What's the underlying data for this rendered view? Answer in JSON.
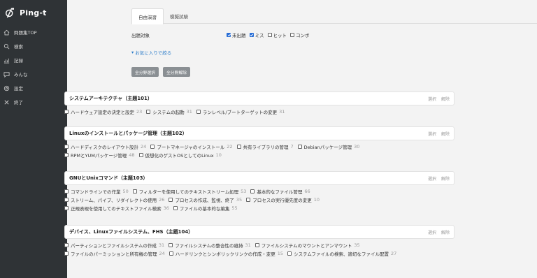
{
  "sidebar": {
    "logo_text": "Ping-t",
    "items": [
      {
        "label": "問題集TOP",
        "icon": "home-icon"
      },
      {
        "label": "検索",
        "icon": "search-icon"
      },
      {
        "label": "記録",
        "icon": "record-icon"
      },
      {
        "label": "みんな",
        "icon": "chat-icon"
      },
      {
        "label": "設定",
        "icon": "gear-icon"
      },
      {
        "label": "終了",
        "icon": "close-icon"
      }
    ]
  },
  "tabs": [
    {
      "label": "自由演習",
      "active": true
    },
    {
      "label": "模擬試験",
      "active": false
    }
  ],
  "filter": {
    "label": "出題対象",
    "options": [
      {
        "label": "未出題",
        "checked": true
      },
      {
        "label": "ミス",
        "checked": true
      },
      {
        "label": "ヒット",
        "checked": false
      },
      {
        "label": "コンボ",
        "checked": false
      }
    ]
  },
  "favorites_link": "お気に入りで絞る",
  "buttons": {
    "select_all": "全分野選択",
    "deselect_all": "全分野解除"
  },
  "card_actions": {
    "select": "選択",
    "release": "解除"
  },
  "sections": [
    {
      "title": "システムアーキテクチャ（主題101）",
      "lines": [
        [
          {
            "label": "ハードウェア設定の決定と設定",
            "count": "23"
          },
          {
            "label": "システムの起動",
            "count": "31"
          },
          {
            "label": "ランレベル/ブートターゲットの変更",
            "count": "31"
          }
        ]
      ]
    },
    {
      "title": "Linuxのインストールとパッケージ管理（主題102）",
      "lines": [
        [
          {
            "label": "ハードディスクのレイアウト設計",
            "count": "24"
          },
          {
            "label": "ブートマネージャのインストール",
            "count": "22"
          },
          {
            "label": "共有ライブラリの管理",
            "count": "7"
          },
          {
            "label": "Debianパッケージ管理",
            "count": "30"
          }
        ],
        [
          {
            "label": "RPMとYUMパッケージ管理",
            "count": "48"
          },
          {
            "label": "仮想化のゲストOSとしてのLinux",
            "count": "10"
          }
        ]
      ]
    },
    {
      "title": "GNUとUnixコマンド（主題103）",
      "lines": [
        [
          {
            "label": "コマンドラインでの作業",
            "count": "50"
          },
          {
            "label": "フィルターを使用してのテキストストリーム処理",
            "count": "53"
          },
          {
            "label": "基本的なファイル管理",
            "count": "66"
          }
        ],
        [
          {
            "label": "ストリーム、パイプ、リダイレクトの使用",
            "count": "26"
          },
          {
            "label": "プロセスの作成、監視、終了",
            "count": "35"
          },
          {
            "label": "プロセスの実行優先度の変更",
            "count": "10"
          }
        ],
        [
          {
            "label": "正規表現を使用してのテキストファイル検索",
            "count": "36"
          },
          {
            "label": "ファイルの基本的な編集",
            "count": "55"
          }
        ]
      ]
    },
    {
      "title": "デバイス、Linuxファイルシステム、FHS（主題104）",
      "lines": [
        [
          {
            "label": "パーティションとファイルシステムの作成",
            "count": "31"
          },
          {
            "label": "ファイルシステムの整合性の維持",
            "count": "31"
          },
          {
            "label": "ファイルシステムのマウントとアンマウント",
            "count": "35"
          }
        ],
        [
          {
            "label": "ファイルのパーミッションと所有権の管理",
            "count": "24"
          },
          {
            "label": "ハードリンクとシンボリックリンクの作成・変更",
            "count": "15"
          },
          {
            "label": "システムファイルの検索、適切なファイル配置",
            "count": "27"
          }
        ]
      ]
    }
  ]
}
